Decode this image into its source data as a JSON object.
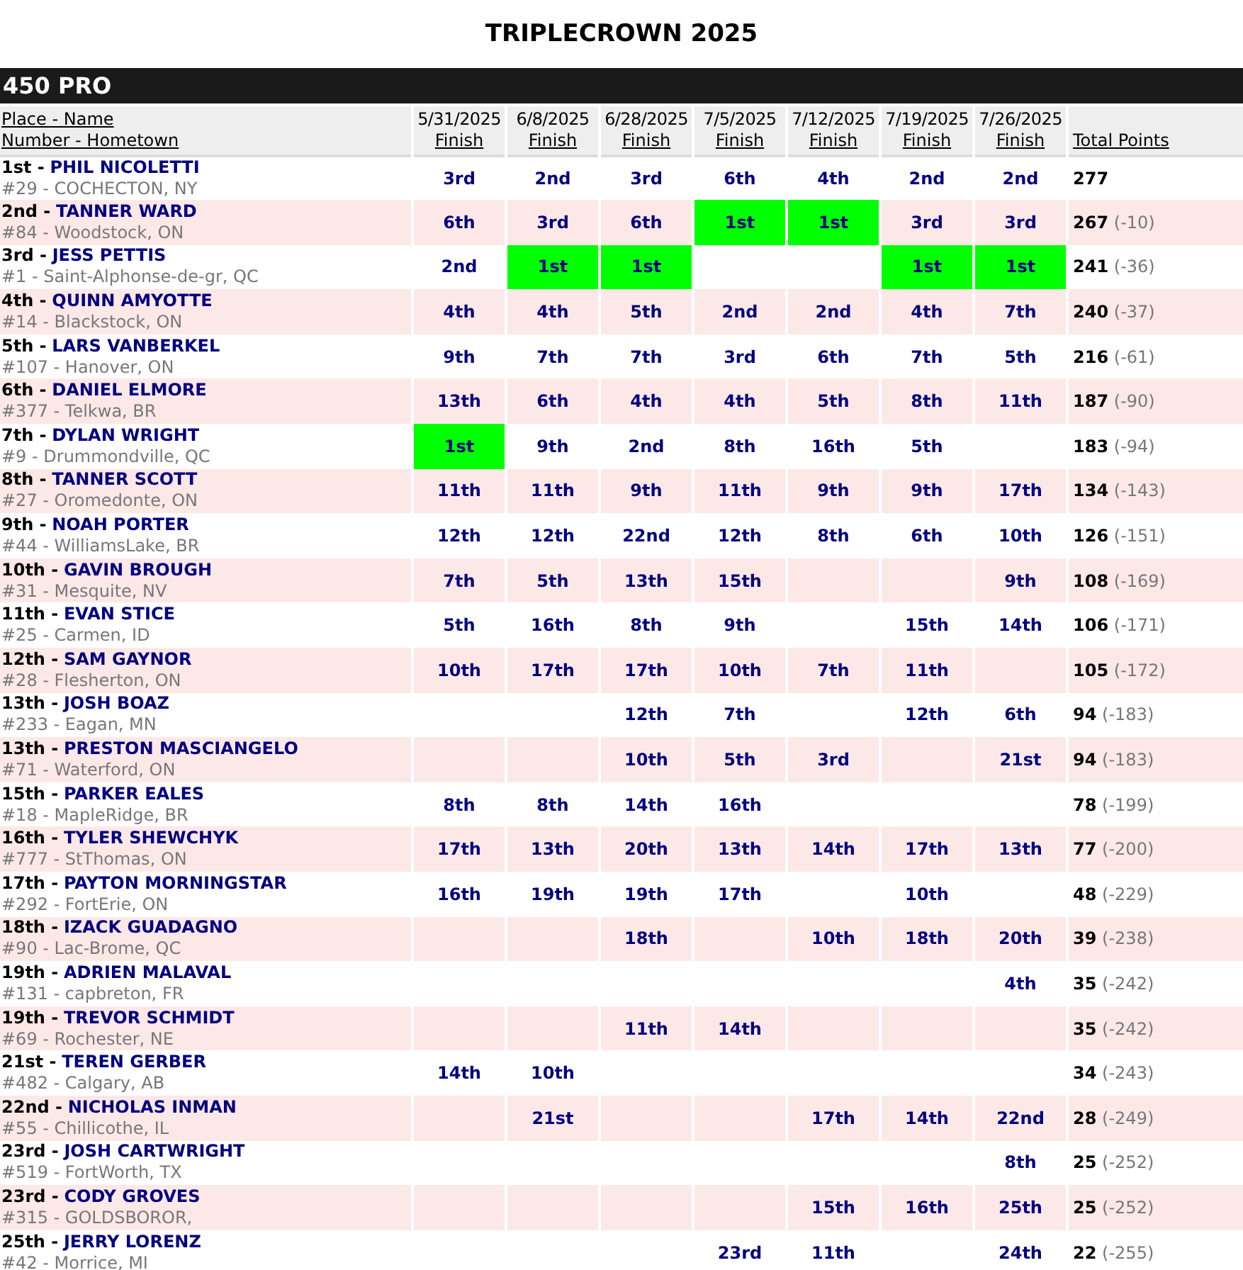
{
  "title": "TRIPLECROWN 2025",
  "class_name": "450 PRO",
  "columns": {
    "rider_line1": "Place - Name",
    "rider_line2": "Number - Hometown",
    "events": [
      {
        "date": "5/31/2025",
        "label": "Finish"
      },
      {
        "date": "6/8/2025",
        "label": "Finish"
      },
      {
        "date": "6/28/2025",
        "label": "Finish"
      },
      {
        "date": "7/5/2025",
        "label": "Finish"
      },
      {
        "date": "7/12/2025",
        "label": "Finish"
      },
      {
        "date": "7/19/2025",
        "label": "Finish"
      },
      {
        "date": "7/26/2025",
        "label": "Finish"
      }
    ],
    "total": "Total Points"
  },
  "rows": [
    {
      "place": "1st -",
      "name": "PHIL NICOLETTI",
      "info": "#29 - COCHECTON, NY",
      "results": {
        "finish_1": {
          "place": "3rd",
          "win": false
        },
        "finish_2": {
          "place": "2nd",
          "win": false
        },
        "finish_3": {
          "place": "3rd",
          "win": false
        },
        "finish_4": {
          "place": "6th",
          "win": false
        },
        "finish_5": {
          "place": "4th",
          "win": false
        },
        "finish_6": {
          "place": "2nd",
          "win": false
        },
        "finish_7": {
          "place": "2nd",
          "win": false
        }
      },
      "points": "277"
    },
    {
      "place": "2nd -",
      "name": "TANNER WARD",
      "info": "#84 - Woodstock, ON",
      "results": {
        "finish_1": {
          "place": "6th",
          "win": false
        },
        "finish_2": {
          "place": "3rd",
          "win": false
        },
        "finish_3": {
          "place": "6th",
          "win": false
        },
        "finish_4": {
          "place": "1st",
          "win": true
        },
        "finish_5": {
          "place": "1st",
          "win": true
        },
        "finish_6": {
          "place": "3rd",
          "win": false
        },
        "finish_7": {
          "place": "3rd",
          "win": false
        }
      },
      "points": "267",
      "behind": "(-10)"
    },
    {
      "place": "3rd -",
      "name": "JESS PETTIS",
      "info": "#1 - Saint-Alphonse-de-gr, QC",
      "results": {
        "finish_1": {
          "place": "2nd",
          "win": false
        },
        "finish_2": {
          "place": "1st",
          "win": true
        },
        "finish_3": {
          "place": "1st",
          "win": true
        },
        "finish_6": {
          "place": "1st",
          "win": true
        },
        "finish_7": {
          "place": "1st",
          "win": true
        }
      },
      "points": "241",
      "behind": "(-36)"
    },
    {
      "place": "4th -",
      "name": "QUINN AMYOTTE",
      "info": "#14 - Blackstock, ON",
      "results": {
        "finish_1": {
          "place": "4th",
          "win": false
        },
        "finish_2": {
          "place": "4th",
          "win": false
        },
        "finish_3": {
          "place": "5th",
          "win": false
        },
        "finish_4": {
          "place": "2nd",
          "win": false
        },
        "finish_5": {
          "place": "2nd",
          "win": false
        },
        "finish_6": {
          "place": "4th",
          "win": false
        },
        "finish_7": {
          "place": "7th",
          "win": false
        }
      },
      "points": "240",
      "behind": "(-37)"
    },
    {
      "place": "5th -",
      "name": "LARS VANBERKEL",
      "info": "#107 - Hanover, ON",
      "results": {
        "finish_1": {
          "place": "9th",
          "win": false
        },
        "finish_2": {
          "place": "7th",
          "win": false
        },
        "finish_3": {
          "place": "7th",
          "win": false
        },
        "finish_4": {
          "place": "3rd",
          "win": false
        },
        "finish_5": {
          "place": "6th",
          "win": false
        },
        "finish_6": {
          "place": "7th",
          "win": false
        },
        "finish_7": {
          "place": "5th",
          "win": false
        }
      },
      "points": "216",
      "behind": "(-61)"
    },
    {
      "place": "6th -",
      "name": "DANIEL ELMORE",
      "info": "#377 - Telkwa, BR",
      "results": {
        "finish_1": {
          "place": "13th",
          "win": false
        },
        "finish_2": {
          "place": "6th",
          "win": false
        },
        "finish_3": {
          "place": "4th",
          "win": false
        },
        "finish_4": {
          "place": "4th",
          "win": false
        },
        "finish_5": {
          "place": "5th",
          "win": false
        },
        "finish_6": {
          "place": "8th",
          "win": false
        },
        "finish_7": {
          "place": "11th",
          "win": false
        }
      },
      "points": "187",
      "behind": "(-90)"
    },
    {
      "place": "7th -",
      "name": "DYLAN WRIGHT",
      "info": "#9 - Drummondville, QC",
      "results": {
        "finish_1": {
          "place": "1st",
          "win": true
        },
        "finish_2": {
          "place": "9th",
          "win": false
        },
        "finish_3": {
          "place": "2nd",
          "win": false
        },
        "finish_4": {
          "place": "8th",
          "win": false
        },
        "finish_5": {
          "place": "16th",
          "win": false
        },
        "finish_6": {
          "place": "5th",
          "win": false
        }
      },
      "points": "183",
      "behind": "(-94)"
    },
    {
      "place": "8th -",
      "name": "TANNER SCOTT",
      "info": "#27 - Oromedonte, ON",
      "results": {
        "finish_1": {
          "place": "11th",
          "win": false
        },
        "finish_2": {
          "place": "11th",
          "win": false
        },
        "finish_3": {
          "place": "9th",
          "win": false
        },
        "finish_4": {
          "place": "11th",
          "win": false
        },
        "finish_5": {
          "place": "9th",
          "win": false
        },
        "finish_6": {
          "place": "9th",
          "win": false
        },
        "finish_7": {
          "place": "17th",
          "win": false
        }
      },
      "points": "134",
      "behind": "(-143)"
    },
    {
      "place": "9th -",
      "name": "NOAH PORTER",
      "info": "#44 - WilliamsLake, BR",
      "results": {
        "finish_1": {
          "place": "12th",
          "win": false
        },
        "finish_2": {
          "place": "12th",
          "win": false
        },
        "finish_3": {
          "place": "22nd",
          "win": false
        },
        "finish_4": {
          "place": "12th",
          "win": false
        },
        "finish_5": {
          "place": "8th",
          "win": false
        },
        "finish_6": {
          "place": "6th",
          "win": false
        },
        "finish_7": {
          "place": "10th",
          "win": false
        }
      },
      "points": "126",
      "behind": "(-151)"
    },
    {
      "place": "10th -",
      "name": "GAVIN BROUGH",
      "info": "#31 - Mesquite, NV",
      "results": {
        "finish_1": {
          "place": "7th",
          "win": false
        },
        "finish_2": {
          "place": "5th",
          "win": false
        },
        "finish_3": {
          "place": "13th",
          "win": false
        },
        "finish_4": {
          "place": "15th",
          "win": false
        },
        "finish_7": {
          "place": "9th",
          "win": false
        }
      },
      "points": "108",
      "behind": "(-169)"
    },
    {
      "place": "11th -",
      "name": "EVAN STICE",
      "info": "#25 - Carmen, ID",
      "results": {
        "finish_1": {
          "place": "5th",
          "win": false
        },
        "finish_2": {
          "place": "16th",
          "win": false
        },
        "finish_3": {
          "place": "8th",
          "win": false
        },
        "finish_4": {
          "place": "9th",
          "win": false
        },
        "finish_6": {
          "place": "15th",
          "win": false
        },
        "finish_7": {
          "place": "14th",
          "win": false
        }
      },
      "points": "106",
      "behind": "(-171)"
    },
    {
      "place": "12th -",
      "name": "SAM GAYNOR",
      "info": "#28 - Flesherton, ON",
      "results": {
        "finish_1": {
          "place": "10th",
          "win": false
        },
        "finish_2": {
          "place": "17th",
          "win": false
        },
        "finish_3": {
          "place": "17th",
          "win": false
        },
        "finish_4": {
          "place": "10th",
          "win": false
        },
        "finish_5": {
          "place": "7th",
          "win": false
        },
        "finish_6": {
          "place": "11th",
          "win": false
        }
      },
      "points": "105",
      "behind": "(-172)"
    },
    {
      "place": "13th -",
      "name": "JOSH BOAZ",
      "info": "#233 - Eagan, MN",
      "results": {
        "finish_3": {
          "place": "12th",
          "win": false
        },
        "finish_4": {
          "place": "7th",
          "win": false
        },
        "finish_6": {
          "place": "12th",
          "win": false
        },
        "finish_7": {
          "place": "6th",
          "win": false
        }
      },
      "points": "94",
      "behind": "(-183)"
    },
    {
      "place": "13th -",
      "name": "PRESTON MASCIANGELO",
      "info": "#71 - Waterford, ON",
      "results": {
        "finish_3": {
          "place": "10th",
          "win": false
        },
        "finish_4": {
          "place": "5th",
          "win": false
        },
        "finish_5": {
          "place": "3rd",
          "win": false
        },
        "finish_7": {
          "place": "21st",
          "win": false
        }
      },
      "points": "94",
      "behind": "(-183)"
    },
    {
      "place": "15th -",
      "name": "PARKER EALES",
      "info": "#18 - MapleRidge, BR",
      "results": {
        "finish_1": {
          "place": "8th",
          "win": false
        },
        "finish_2": {
          "place": "8th",
          "win": false
        },
        "finish_3": {
          "place": "14th",
          "win": false
        },
        "finish_4": {
          "place": "16th",
          "win": false
        }
      },
      "points": "78",
      "behind": "(-199)"
    },
    {
      "place": "16th -",
      "name": "TYLER SHEWCHYK",
      "info": "#777 - StThomas, ON",
      "results": {
        "finish_1": {
          "place": "17th",
          "win": false
        },
        "finish_2": {
          "place": "13th",
          "win": false
        },
        "finish_3": {
          "place": "20th",
          "win": false
        },
        "finish_4": {
          "place": "13th",
          "win": false
        },
        "finish_5": {
          "place": "14th",
          "win": false
        },
        "finish_6": {
          "place": "17th",
          "win": false
        },
        "finish_7": {
          "place": "13th",
          "win": false
        }
      },
      "points": "77",
      "behind": "(-200)"
    },
    {
      "place": "17th -",
      "name": "PAYTON MORNINGSTAR",
      "info": "#292 - FortErie, ON",
      "results": {
        "finish_1": {
          "place": "16th",
          "win": false
        },
        "finish_2": {
          "place": "19th",
          "win": false
        },
        "finish_3": {
          "place": "19th",
          "win": false
        },
        "finish_4": {
          "place": "17th",
          "win": false
        },
        "finish_6": {
          "place": "10th",
          "win": false
        }
      },
      "points": "48",
      "behind": "(-229)"
    },
    {
      "place": "18th -",
      "name": "IZACK GUADAGNO",
      "info": "#90 - Lac-Brome, QC",
      "results": {
        "finish_3": {
          "place": "18th",
          "win": false
        },
        "finish_5": {
          "place": "10th",
          "win": false
        },
        "finish_6": {
          "place": "18th",
          "win": false
        },
        "finish_7": {
          "place": "20th",
          "win": false
        }
      },
      "points": "39",
      "behind": "(-238)"
    },
    {
      "place": "19th -",
      "name": "ADRIEN MALAVAL",
      "info": "#131 - capbreton, FR",
      "results": {
        "finish_7": {
          "place": "4th",
          "win": false
        }
      },
      "points": "35",
      "behind": "(-242)"
    },
    {
      "place": "19th -",
      "name": "TREVOR SCHMIDT",
      "info": "#69 - Rochester, NE",
      "results": {
        "finish_3": {
          "place": "11th",
          "win": false
        },
        "finish_4": {
          "place": "14th",
          "win": false
        }
      },
      "points": "35",
      "behind": "(-242)"
    },
    {
      "place": "21st -",
      "name": "TEREN GERBER",
      "info": "#482 - Calgary, AB",
      "results": {
        "finish_1": {
          "place": "14th",
          "win": false
        },
        "finish_2": {
          "place": "10th",
          "win": false
        }
      },
      "points": "34",
      "behind": "(-243)"
    },
    {
      "place": "22nd -",
      "name": "NICHOLAS INMAN",
      "info": "#55 - Chillicothe, IL",
      "results": {
        "finish_2": {
          "place": "21st",
          "win": false
        },
        "finish_5": {
          "place": "17th",
          "win": false
        },
        "finish_6": {
          "place": "14th",
          "win": false
        },
        "finish_7": {
          "place": "22nd",
          "win": false
        }
      },
      "points": "28",
      "behind": "(-249)"
    },
    {
      "place": "23rd -",
      "name": "JOSH CARTWRIGHT",
      "info": "#519 - FortWorth, TX",
      "results": {
        "finish_7": {
          "place": "8th",
          "win": false
        }
      },
      "points": "25",
      "behind": "(-252)"
    },
    {
      "place": "23rd -",
      "name": "CODY GROVES",
      "info": "#315 - GOLDSBOROR,",
      "results": {
        "finish_5": {
          "place": "15th",
          "win": false
        },
        "finish_6": {
          "place": "16th",
          "win": false
        },
        "finish_7": {
          "place": "25th",
          "win": false
        }
      },
      "points": "25",
      "behind": "(-252)"
    },
    {
      "place": "25th -",
      "name": "JERRY LORENZ",
      "info": "#42 - Morrice, MI",
      "results": {
        "finish_4": {
          "place": "23rd",
          "win": false
        },
        "finish_5": {
          "place": "11th",
          "win": false
        },
        "finish_7": {
          "place": "24th",
          "win": false
        }
      },
      "points": "22",
      "behind": "(-255)"
    }
  ]
}
